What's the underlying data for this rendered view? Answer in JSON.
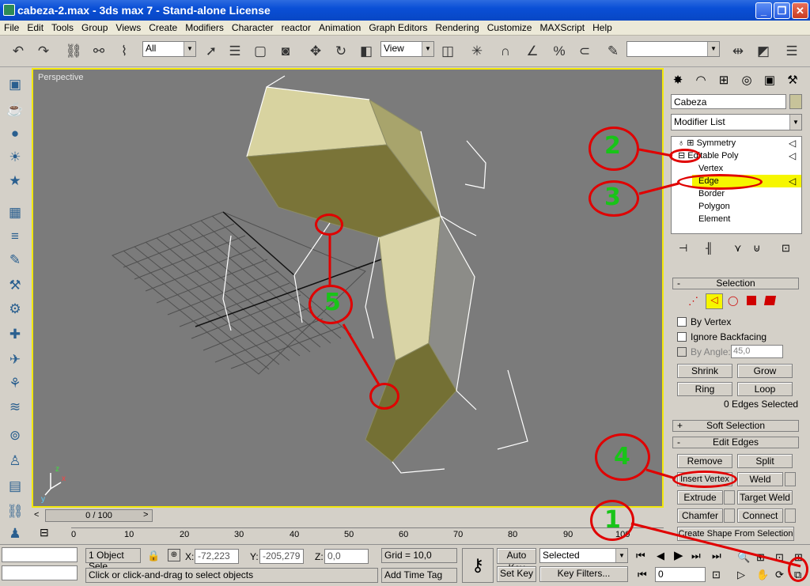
{
  "window": {
    "title": "cabeza-2.max - 3ds max 7 - Stand-alone License"
  },
  "menu": [
    "File",
    "Edit",
    "Tools",
    "Group",
    "Views",
    "Create",
    "Modifiers",
    "Character",
    "reactor",
    "Animation",
    "Graph Editors",
    "Rendering",
    "Customize",
    "MAXScript",
    "Help"
  ],
  "toolbar": {
    "selection_filter": "All",
    "ref_coord": "View",
    "named_selection": ""
  },
  "viewport": {
    "label": "Perspective"
  },
  "command_panel": {
    "object_name": "Cabeza",
    "modifier_list": "Modifier List",
    "stack": [
      "Symmetry",
      "Editable Poly",
      "Vertex",
      "Edge",
      "Border",
      "Polygon",
      "Element"
    ],
    "selection": {
      "title": "Selection",
      "by_vertex": "By Vertex",
      "ignore_backfacing": "Ignore Backfacing",
      "by_angle": "By Angle:",
      "angle_value": "45,0",
      "shrink": "Shrink",
      "grow": "Grow",
      "ring": "Ring",
      "loop": "Loop",
      "status": "0 Edges Selected"
    },
    "soft_selection": "Soft Selection",
    "edit_edges": {
      "title": "Edit Edges",
      "remove": "Remove",
      "split": "Split",
      "insert_vertex": "Insert Vertex",
      "weld": "Weld",
      "extrude": "Extrude",
      "target_weld": "Target Weld",
      "chamfer": "Chamfer",
      "connect": "Connect",
      "create_shape": "Create Shape From Selection"
    }
  },
  "timeline": {
    "slider": "0 / 100",
    "ticks": [
      "0",
      "10",
      "20",
      "30",
      "40",
      "50",
      "60",
      "70",
      "80",
      "90",
      "100"
    ]
  },
  "status": {
    "objects": "1 Object Sele",
    "x_label": "X:",
    "x": "-72,223",
    "y_label": "Y:",
    "y": "-205,279",
    "z_label": "Z:",
    "z": "0,0",
    "grid": "Grid = 10,0",
    "prompt": "Click or click-and-drag to select objects",
    "add_time_tag": "Add Time Tag",
    "auto_key": "Auto Key",
    "set_key": "Set Key",
    "key_mode": "Selected",
    "key_filters": "Key Filters...",
    "frame": "0"
  },
  "annotations": [
    "1",
    "2",
    "3",
    "4",
    "5"
  ],
  "colors": {
    "accent_red": "#e00000",
    "annot_green": "#18c418",
    "highlight_yellow": "#f3e80c"
  }
}
